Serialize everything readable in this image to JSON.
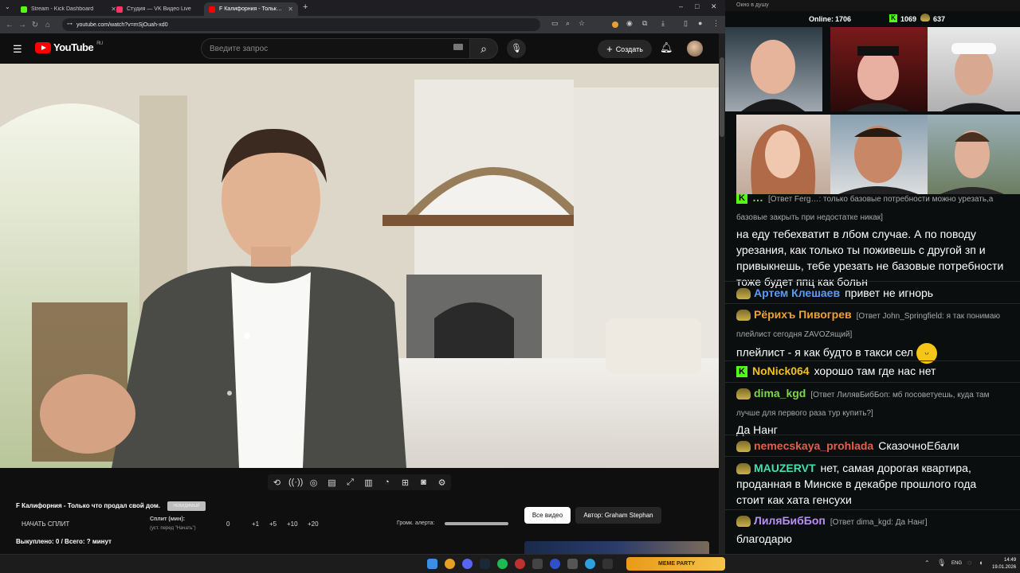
{
  "browser": {
    "tabs": [
      {
        "title": "Stream - Kick Dashboard",
        "color": "#53fc18"
      },
      {
        "title": "Студия — VK Видео Live",
        "color": "#ff3366"
      },
      {
        "title": "F Калифорния - Только что про",
        "color": "#ff0000"
      }
    ],
    "url": "youtube.com/watch?v=mSjOuah-xd0"
  },
  "youtube": {
    "logo_text": "YouTube",
    "region": "RU",
    "search_placeholder": "Введите запрос",
    "create_label": "Создать"
  },
  "video_info": {
    "title": "F Калифорния - Только что продал свой дом.",
    "tag": "НЕВИДИМЫЙ",
    "start_split": "НАЧАТЬ СПЛИТ",
    "split_label": "Сплит (мин):",
    "split_hint": "(уст. перед \"Начать\")",
    "split_value": "0",
    "increments": [
      "+1",
      "+5",
      "+10",
      "+20"
    ],
    "volume_label": "Громк. алерта:",
    "bought": "Выкуплено: 0 / Всего: ? минут",
    "all_videos": "Все видео",
    "author": "Автор: Graham Stephan"
  },
  "right_panel": {
    "window_title": "Окно в душу",
    "online_label": "Online:",
    "online_count": "1706",
    "kick_count": "1069",
    "vk_count": "637"
  },
  "chat": [
    {
      "nick": "…",
      "nick_color": "#7fd44a",
      "reply": "[Ответ Ferg…: только базовые потребности можно урезать,а базовые закрыть при недостатке никак]",
      "text": "на еду тебехватит в лбом случае. А по поводу урезания, как только ты поживешь с другой зп и привыкнешь, тебе урезать не базовые потребности тоже будет ппц как больн"
    },
    {
      "nick": "Артем Клешаев",
      "nick_color": "#5b9cf5",
      "reply": "",
      "text": "привет не игнорь"
    },
    {
      "nick": "Рёрихъ Пивогрев",
      "nick_color": "#f0a030",
      "reply": "[Ответ John_Springfield: я так понимаю плейлист сегодня ZAVOZящий]",
      "text": "плейлист - я как будто в такси сел"
    },
    {
      "nick": "NoNick064",
      "nick_color": "#f0c020",
      "reply": "",
      "text": "хорошо там где нас нет"
    },
    {
      "nick": "dima_kgd",
      "nick_color": "#7fd44a",
      "reply": "[Ответ ЛилявБибБоп: мб посоветуешь, куда там лучше для первого раза тур купить?]",
      "text": "Да Нанг"
    },
    {
      "nick": "nemecskaya_prohlada",
      "nick_color": "#e0604a",
      "reply": "",
      "text": "СказочноЕбали"
    },
    {
      "nick": "MAUZERVT",
      "nick_color": "#40e0b0",
      "reply": "",
      "text": "нет, самая дорогая квартира, проданная в Минске в декабре прошлого года стоит как хата генсухи"
    },
    {
      "nick": "ЛиляБибБоп",
      "nick_color": "#b890f8",
      "reply": "[Ответ dima_kgd: Да Нанг]",
      "text": "благодарю"
    }
  ],
  "taskbar": {
    "meme_label": "MEME PARTY",
    "lang": "ENG",
    "time": "14:49",
    "date": "19.01.2026"
  }
}
